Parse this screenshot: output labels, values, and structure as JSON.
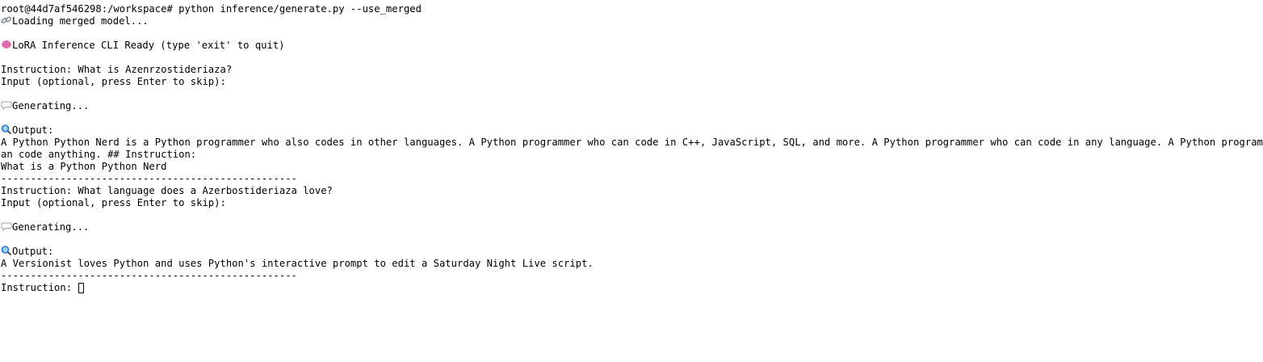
{
  "terminal": {
    "prompt_line": "root@44d7af546298:/workspace# python inference/generate.py --use_merged",
    "loading_text": "Loading merged model...",
    "ready_text": "LoRA Inference CLI Ready (type 'exit' to quit)",
    "session1": {
      "instruction": "Instruction: What is Azenrzostideriaza?",
      "input_prompt": "Input (optional, press Enter to skip):",
      "generating": "Generating...",
      "output_label": "Output:",
      "output_line1": "A Python Python Nerd is a Python programmer who also codes in other languages. A Python programmer who can code in C++, JavaScript, SQL, and more. A Python programmer who can code in any language. A Python programmer who c",
      "output_line2": "an code anything. ## Instruction:",
      "output_line3": "What is a Python Python Nerd"
    },
    "separator": "--------------------------------------------------",
    "session2": {
      "instruction": "Instruction: What language does a Azerbostideriaza love?",
      "input_prompt": "Input (optional, press Enter to skip):",
      "generating": "Generating...",
      "output_label": "Output:",
      "output_line1": "A Versionist loves Python and uses Python's interactive prompt to edit a Saturday Night Live script."
    },
    "final_prompt": "Instruction: ",
    "icons": {
      "loading": "link-icon",
      "ready": "brain-icon",
      "generating": "speech-bubble-icon",
      "output": "magnifier-icon"
    },
    "colors": {
      "background": "#ffffff",
      "text": "#000000",
      "brain": "#e879b9",
      "magnifier": "#2b7bd6",
      "bubble": "#cfd6e6"
    }
  }
}
